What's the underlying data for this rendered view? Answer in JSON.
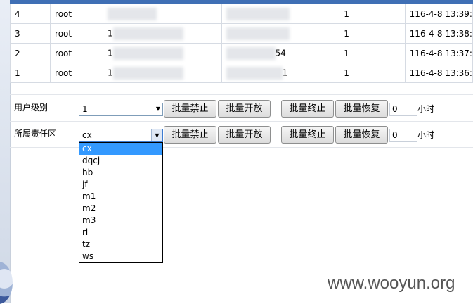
{
  "table": {
    "rows": [
      {
        "id": "4",
        "user": "root",
        "count": "1",
        "time": "116-4-8 13:39:"
      },
      {
        "id": "3",
        "user": "root",
        "count": "1",
        "time": "116-4-8 13:38:"
      },
      {
        "id": "2",
        "user": "root",
        "count": "1",
        "time": "116-4-8 13:37:"
      },
      {
        "id": "1",
        "user": "root",
        "count": "1",
        "time": "116-4-8 13:36:"
      }
    ],
    "partials": [
      "1",
      "1",
      "1",
      "54",
      "1"
    ]
  },
  "level_row": {
    "label": "用户级别",
    "select_value": "1",
    "btn_ban": "批量禁止",
    "btn_open": "批量开放",
    "btn_stop": "批量终止",
    "btn_restore": "批量恢复",
    "hours_value": "0",
    "hours_unit": "小时"
  },
  "zone_row": {
    "label": "所属责任区",
    "select_value": "cx",
    "btn_ban": "批量禁止",
    "btn_open": "批量开放",
    "btn_stop": "批量终止",
    "btn_restore": "批量恢复",
    "hours_value": "0",
    "hours_unit": "小时"
  },
  "zone_dropdown": {
    "options": [
      "cx",
      "dqcj",
      "hb",
      "jf",
      "m1",
      "m2",
      "m3",
      "rl",
      "tz",
      "ws"
    ],
    "selected": "cx"
  },
  "watermark": "www.wooyun.org"
}
